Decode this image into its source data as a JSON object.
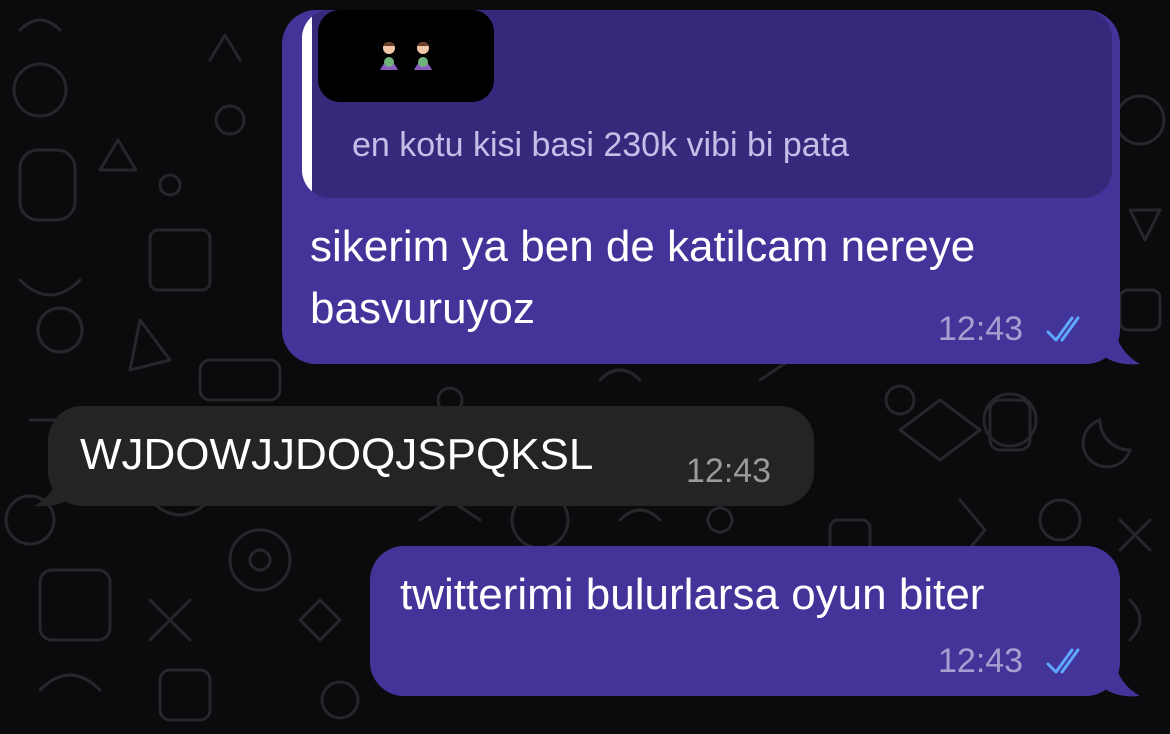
{
  "chat": {
    "messages": [
      {
        "direction": "outgoing",
        "quote": {
          "text": "en kotu kisi basi 230k vibi bi pata",
          "media": "emoji-image"
        },
        "text": "sikerim ya ben de katilcam nereye basvuruyoz",
        "time": "12:43",
        "status": "read"
      },
      {
        "direction": "incoming",
        "text": "WJDOWJJDOQJSPQKSL",
        "time": "12:43"
      },
      {
        "direction": "outgoing",
        "text": "twitterimi bulurlarsa oyun biter",
        "time": "12:43",
        "status": "read"
      }
    ]
  },
  "colors": {
    "background": "#0b0b0d",
    "outgoing_bubble": "#43349a",
    "quote_bubble": "#35297b",
    "incoming_bubble": "#242424",
    "read_ticks": "#5fa8ff"
  },
  "icons": [
    "double-check-icon",
    "emoji-icon"
  ]
}
